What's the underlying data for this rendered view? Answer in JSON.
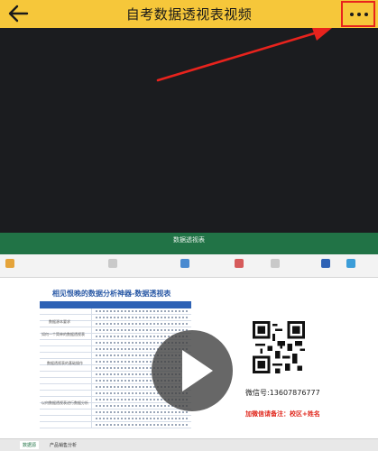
{
  "topbar": {
    "title": "自考数据透视表视频",
    "back_icon": "back-arrow-icon",
    "more_icon": "more-dots-icon",
    "background": "#f6c73a",
    "highlight_color": "#e8231d"
  },
  "video": {
    "window_title": "数据透视表",
    "sheet_title": "相见恨晚的数据分析神器-数据透视表",
    "categories": [
      "数据源本要求",
      "如何一个简单的数据透视表",
      "数据透视表的基础操作",
      "以何数据透视表进行数据分析"
    ],
    "wechat": "微信号:13607876777",
    "note": "加微信请备注：校区+姓名",
    "sheet_tabs": [
      "数据源",
      "产品销售分析"
    ],
    "play_icon": "play-icon"
  }
}
